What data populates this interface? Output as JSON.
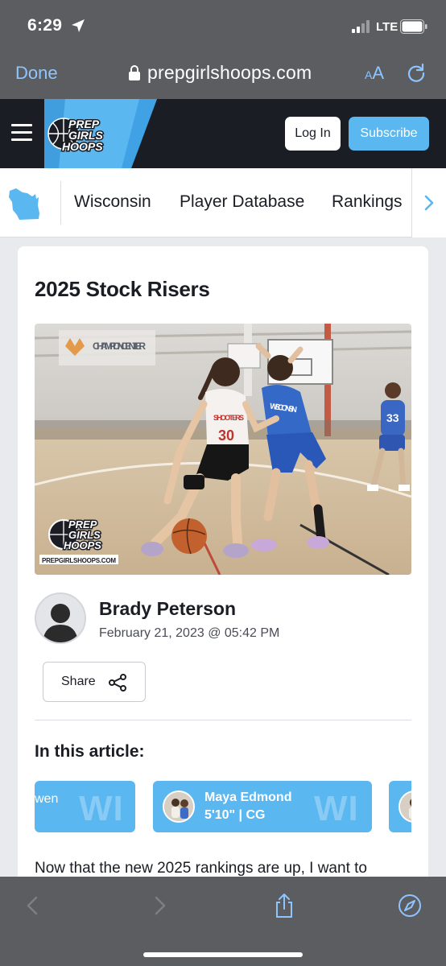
{
  "status_bar": {
    "time": "6:29",
    "network": "LTE"
  },
  "browser": {
    "done_label": "Done",
    "url": "prepgirlshoops.com",
    "text_size_small": "A",
    "text_size_large": "A"
  },
  "header": {
    "logo_lines": [
      "PREP",
      "GIRLS",
      "HOOPS"
    ],
    "login_label": "Log In",
    "subscribe_label": "Subscribe"
  },
  "nav": {
    "items": [
      {
        "label": "Wisconsin"
      },
      {
        "label": "Player Database"
      },
      {
        "label": "Rankings"
      }
    ]
  },
  "article": {
    "title": "2025 Stock Risers",
    "hero": {
      "banner_text": "CHAMPION CENTER",
      "jersey_white": "30",
      "jersey_blue": "33",
      "jersey_team": "WISCONSIN",
      "watermark_lines": [
        "PREP",
        "GIRLS",
        "HOOPS"
      ],
      "watermark_url": "PREPGIRLSHOOPS.COM"
    },
    "author": {
      "name": "Brady Peterson",
      "date": "February 21, 2023 @ 05:42 PM"
    },
    "share_label": "Share",
    "in_this_article": "In this article:",
    "players": [
      {
        "name_fragment": "wen",
        "state": "WI"
      },
      {
        "name": "Maya Edmond",
        "info": "5'10\" | CG",
        "state": "WI"
      }
    ],
    "body_start": "Now that the new 2025 rankings are up, I want to"
  },
  "colors": {
    "accent": "#5bb7f0",
    "link": "#8ec5ff",
    "header_bg": "#1b1d24",
    "chrome_bg": "#5c5d61"
  }
}
